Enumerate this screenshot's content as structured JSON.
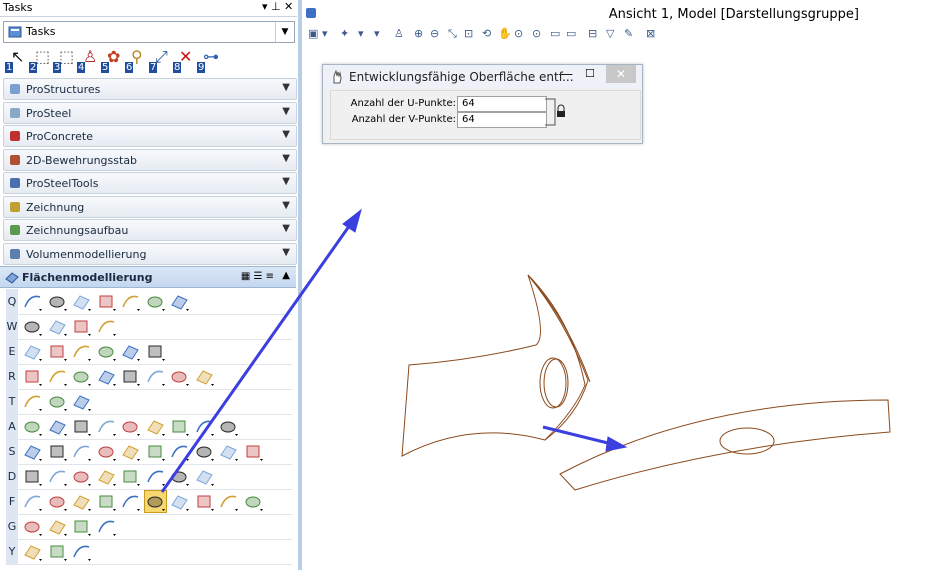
{
  "tasks_panel": {
    "title": "Tasks",
    "pin_glyph": "▾ ⊥",
    "close_glyph": "✕",
    "dropdown_value": "Tasks",
    "numbered_tools": [
      "1",
      "2",
      "3",
      "4",
      "5",
      "6",
      "7",
      "8",
      "9"
    ],
    "sections": [
      {
        "label": "ProStructures",
        "icon": "prostructures-icon"
      },
      {
        "label": "ProSteel",
        "icon": "prosteel-icon"
      },
      {
        "label": "ProConcrete",
        "icon": "proconcrete-icon"
      },
      {
        "label": "2D-Bewehrungsstab",
        "icon": "rebar-icon"
      },
      {
        "label": "ProSteelTools",
        "icon": "prosteeltools-icon"
      },
      {
        "label": "Zeichnung",
        "icon": "drawing-icon"
      },
      {
        "label": "Zeichnungsaufbau",
        "icon": "drawing-setup-icon"
      },
      {
        "label": "Volumenmodellierung",
        "icon": "solid-modeling-icon"
      }
    ],
    "active_section": {
      "label": "Flächenmodellierung",
      "icon": "surface-modeling-icon"
    },
    "row_keys": [
      "Q",
      "W",
      "E",
      "R",
      "T",
      "A",
      "S",
      "D",
      "F",
      "G",
      "Y"
    ],
    "row_tool_counts": [
      7,
      4,
      6,
      8,
      3,
      9,
      10,
      8,
      10,
      4,
      3
    ],
    "highlighted_tool": {
      "row": 8,
      "index": 5
    }
  },
  "view": {
    "title": "Ansicht 1, Model [Darstellungsgruppe]"
  },
  "dialog": {
    "title": "Entwicklungsfähige Oberfläche entf...",
    "minimize_glyph": "—",
    "maximize_glyph": "☐",
    "close_glyph": "✕",
    "fields": [
      {
        "label": "Anzahl der U-Punkte:",
        "value": "64"
      },
      {
        "label": "Anzahl der V-Punkte:",
        "value": "64"
      }
    ]
  },
  "colors": {
    "arrow": "#3b3fe0",
    "curve": "#8b4a1c",
    "panel_accent": "#b8cde6",
    "highlight": "#f7d770"
  }
}
